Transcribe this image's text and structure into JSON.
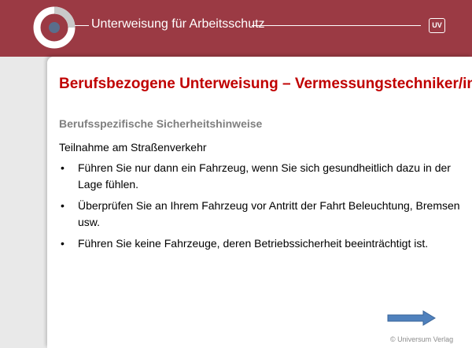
{
  "header": {
    "title": "Unterweisung für Arbeitsschutz",
    "badge": "UV"
  },
  "slide": {
    "title": "Berufsbezogene Unterweisung – Vermessungstechniker/in",
    "subtitle": "Berufsspezifische Sicherheitshinweise",
    "topic": "Teilnahme am Straßenverkehr",
    "bullets": [
      "Führen Sie nur dann ein Fahrzeug, wenn Sie sich gesundheitlich dazu in der Lage fühlen.",
      "Überprüfen Sie an Ihrem Fahrzeug vor Antritt der Fahrt Beleuchtung, Bremsen usw.",
      "Führen Sie keine Fahrzeuge, deren Betriebssicherheit beeinträchtigt ist."
    ],
    "bullet_symbol": "•",
    "copyright": "© Universum Verlag"
  },
  "colors": {
    "header_bg": "#9b3a44",
    "title_red": "#c00000",
    "subtitle_gray": "#7f7f7f",
    "arrow_blue": "#4f81bd"
  },
  "icons": {
    "logo": "ring-logo-icon",
    "next": "right-arrow-icon"
  }
}
